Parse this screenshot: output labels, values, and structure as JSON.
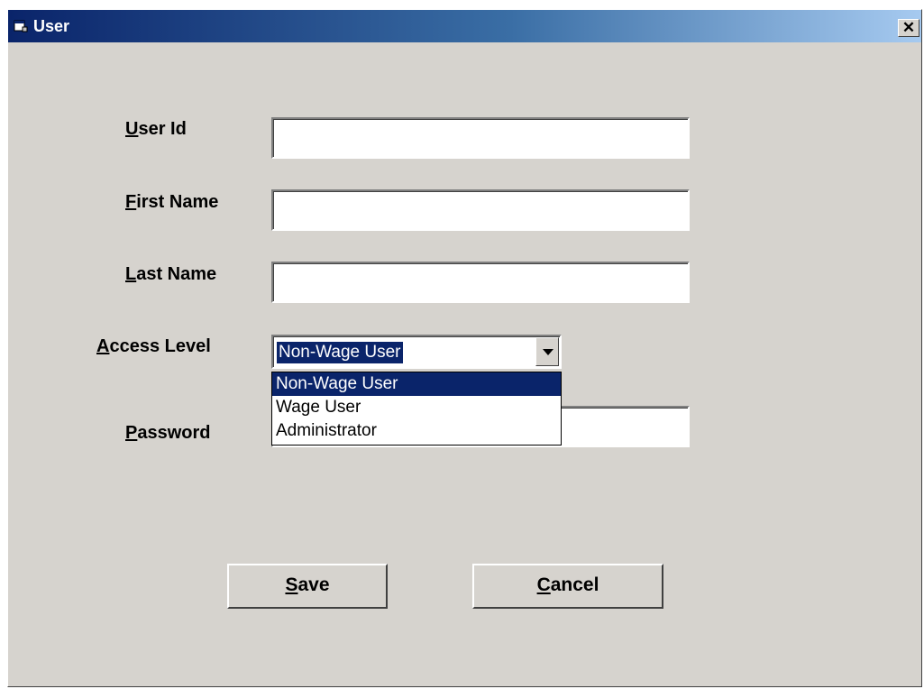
{
  "window": {
    "title": "User",
    "close_label": "✕"
  },
  "form": {
    "user_id": {
      "label_first": "U",
      "label_rest": "ser Id",
      "value": ""
    },
    "first_name": {
      "label_first": "F",
      "label_rest": "irst Name",
      "value": ""
    },
    "last_name": {
      "label_first": "L",
      "label_rest": "ast Name",
      "value": ""
    },
    "access_level": {
      "label_first": "A",
      "label_rest": "ccess Level",
      "selected": "Non-Wage User",
      "options": [
        "Non-Wage User",
        "Wage User",
        "Administrator"
      ]
    },
    "password": {
      "label_first": "P",
      "label_rest": "assword",
      "value": ""
    }
  },
  "buttons": {
    "save": {
      "first": "S",
      "rest": "ave"
    },
    "cancel": {
      "first": "C",
      "rest": "ancel"
    }
  },
  "colors": {
    "face": "#d6d3ce",
    "title_gradient_start": "#0a246a",
    "title_gradient_end": "#a6caf0",
    "selection": "#0a246a"
  },
  "icons": {
    "window_icon": "form-window-icon",
    "close": "close-icon",
    "dropdown": "chevron-down-icon"
  }
}
